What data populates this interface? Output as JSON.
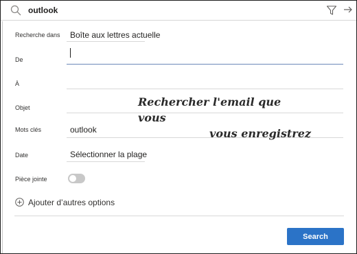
{
  "search": {
    "query": "outlook",
    "icons": {
      "search": "search-icon",
      "filter": "filter-icon",
      "exit": "arrow-right-icon"
    }
  },
  "form": {
    "search_in": {
      "label": "Recherche dans",
      "value": "Boîte aux lettres actuelle"
    },
    "from": {
      "label": "De",
      "value": ""
    },
    "to": {
      "label": "À",
      "value": ""
    },
    "subject": {
      "label": "Objet",
      "value": ""
    },
    "keywords": {
      "label": "Mots clés",
      "value": "outlook"
    },
    "date": {
      "label": "Date",
      "value": "Sélectionner la plage"
    },
    "attachment": {
      "label": "Pièce jointe",
      "enabled": false
    },
    "more_options": "Ajouter d’autres options"
  },
  "actions": {
    "search_label": "Search"
  },
  "annotation": {
    "line1": "Rechercher l'email que vous",
    "line2": "vous enregistrez"
  },
  "colors": {
    "accent": "#2b73c7",
    "underline_active": "#6a87b8"
  }
}
